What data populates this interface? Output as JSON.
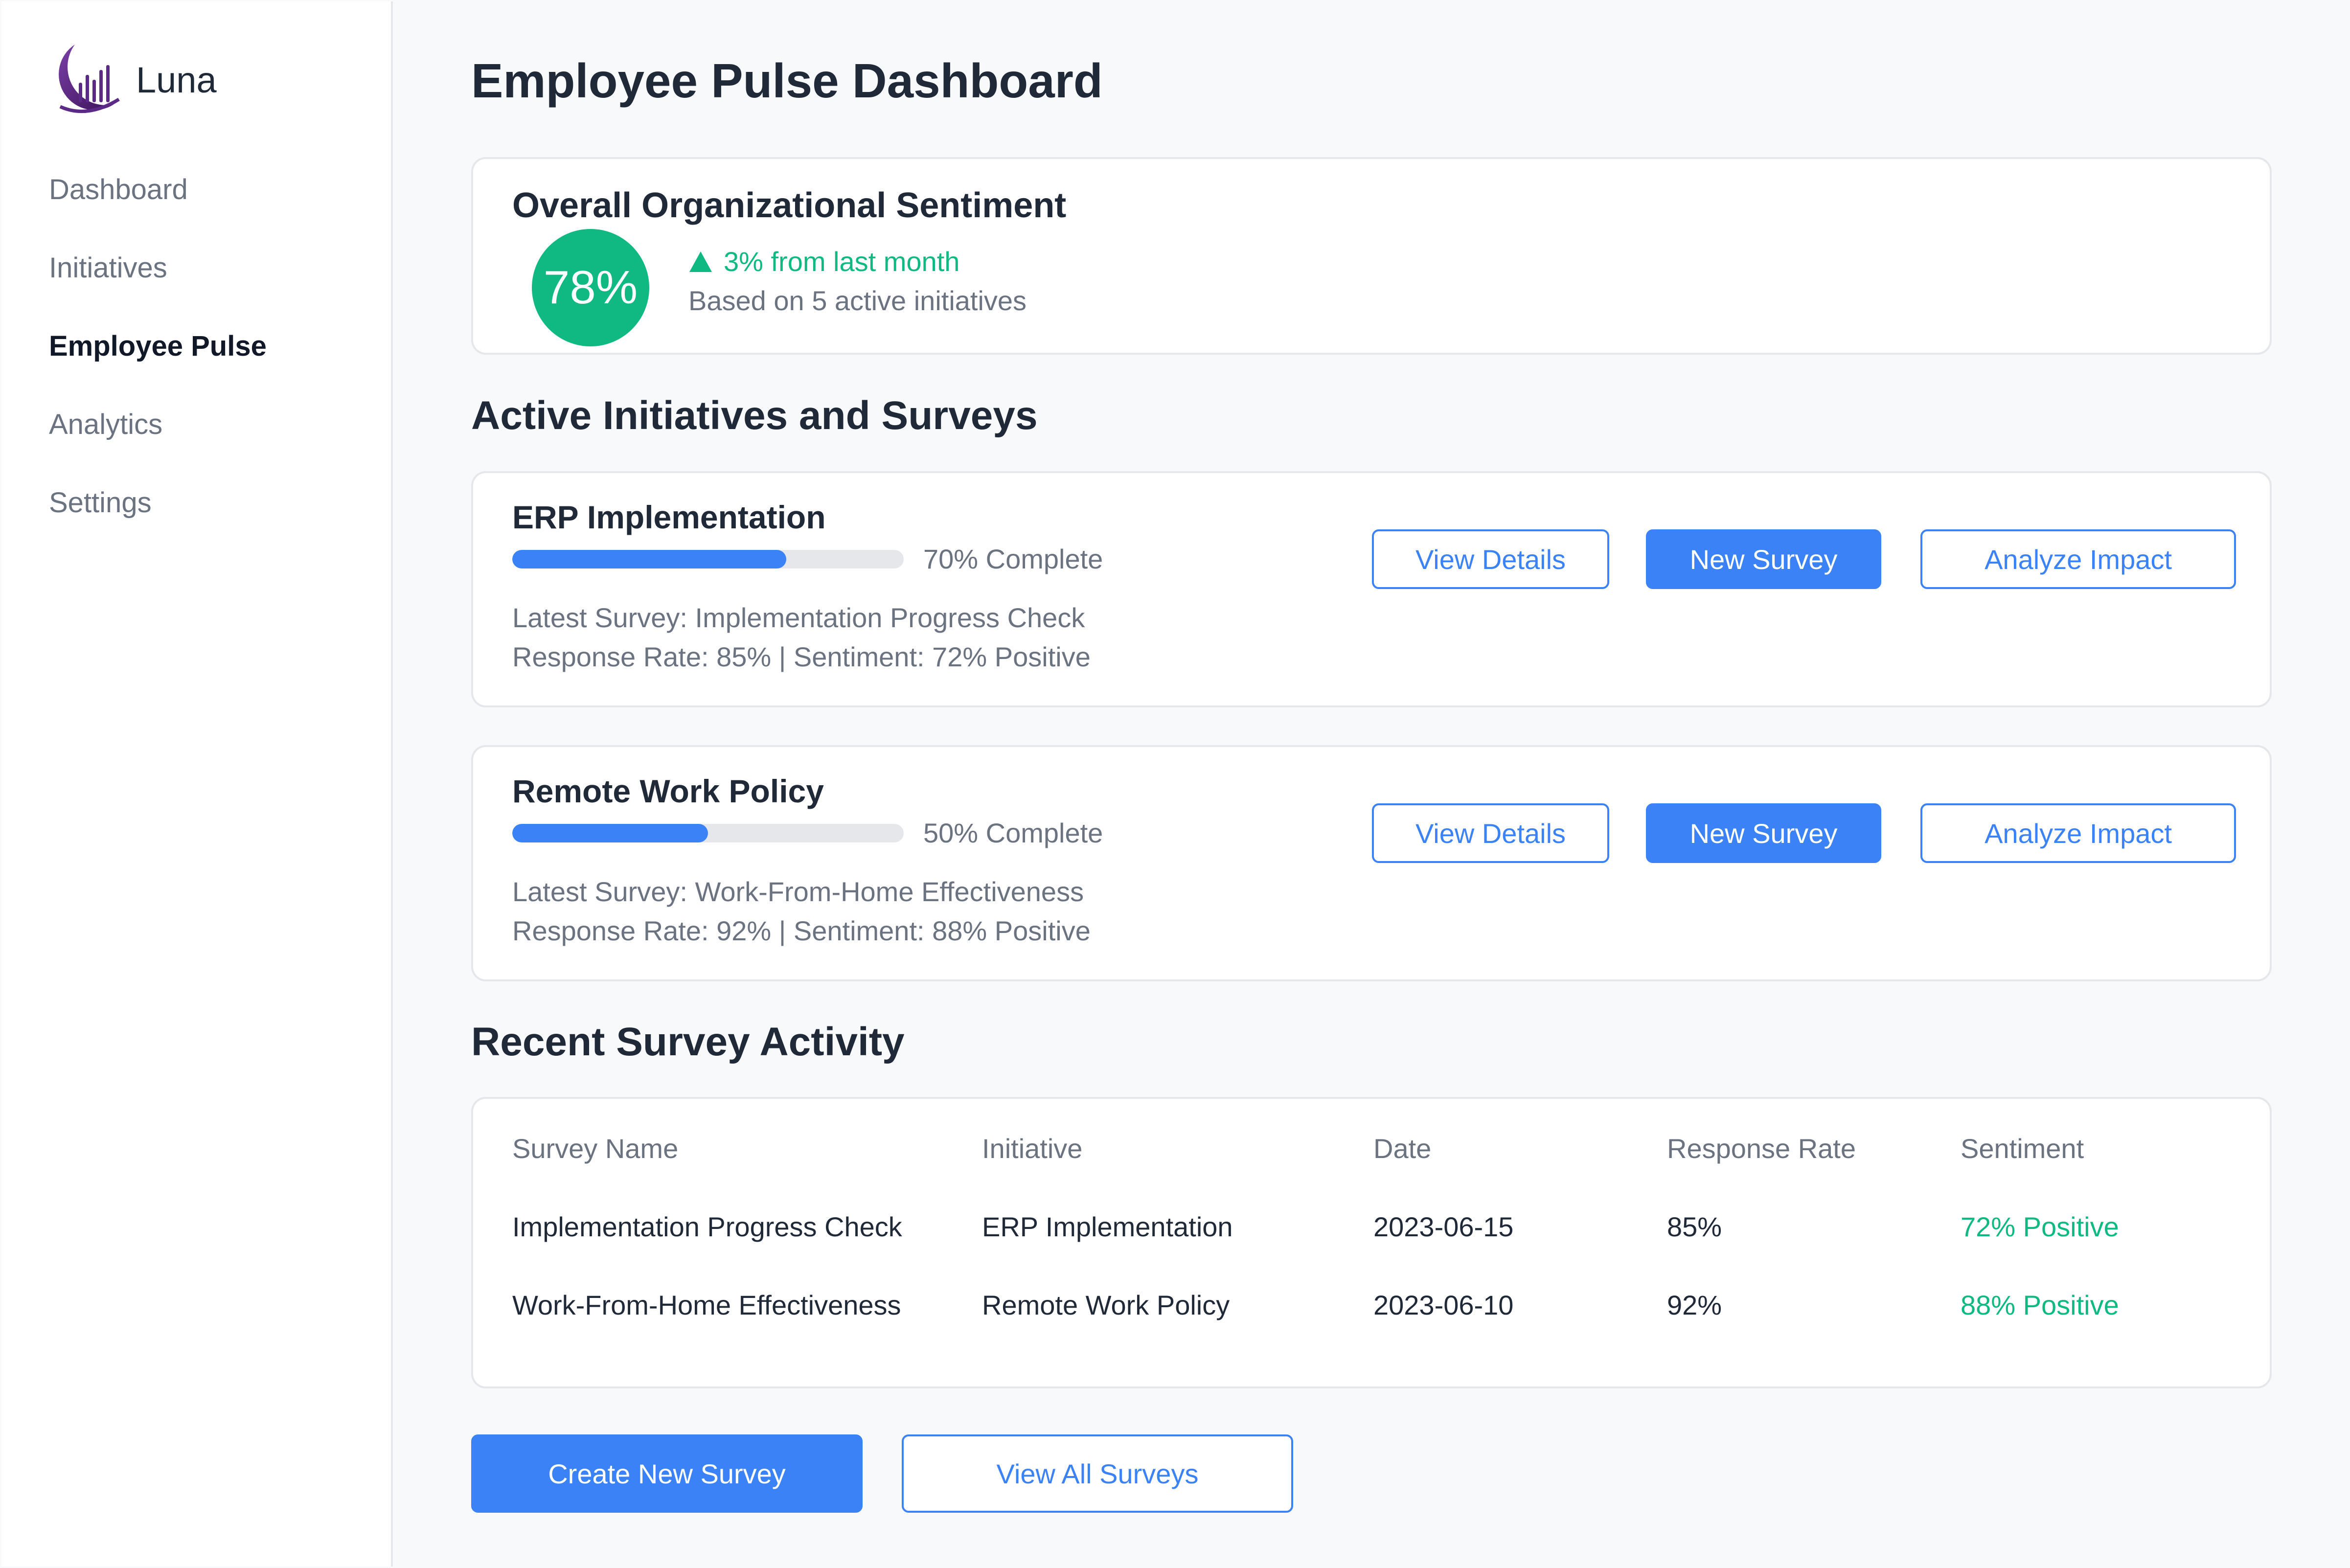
{
  "brand": {
    "name": "Luna",
    "logo_icon": "luna-logo-icon"
  },
  "sidebar": {
    "items": [
      {
        "label": "Dashboard",
        "active": false
      },
      {
        "label": "Initiatives",
        "active": false
      },
      {
        "label": "Employee Pulse",
        "active": true
      },
      {
        "label": "Analytics",
        "active": false
      },
      {
        "label": "Settings",
        "active": false
      }
    ]
  },
  "page": {
    "title": "Employee Pulse Dashboard"
  },
  "sentiment": {
    "title": "Overall Organizational Sentiment",
    "score": "78%",
    "trend_icon": "triangle-up-icon",
    "trend_text": "3% from last month",
    "basis": "Based on 5 active initiatives",
    "color": "#10b981"
  },
  "initiatives_section": {
    "title": "Active Initiatives and Surveys"
  },
  "initiatives": [
    {
      "name": "ERP Implementation",
      "progress": 0.7,
      "progress_label": "70% Complete",
      "latest_survey": "Latest Survey: Implementation Progress Check",
      "stats": "Response Rate: 85% | Sentiment: 72% Positive",
      "view_label": "View Details",
      "new_label": "New Survey",
      "analyze_label": "Analyze Impact"
    },
    {
      "name": "Remote Work Policy",
      "progress": 0.5,
      "progress_label": "50% Complete",
      "latest_survey": "Latest Survey: Work-From-Home Effectiveness",
      "stats": "Response Rate: 92% | Sentiment: 88% Positive",
      "view_label": "View Details",
      "new_label": "New Survey",
      "analyze_label": "Analyze Impact"
    }
  ],
  "activity": {
    "title": "Recent Survey Activity",
    "columns": [
      "Survey Name",
      "Initiative",
      "Date",
      "Response Rate",
      "Sentiment"
    ],
    "rows": [
      [
        "Implementation Progress Check",
        "ERP Implementation",
        "2023-06-15",
        "85%",
        "72% Positive"
      ],
      [
        "Work-From-Home Effectiveness",
        "Remote Work Policy",
        "2023-06-10",
        "92%",
        "88% Positive"
      ]
    ]
  },
  "actions": {
    "create_label": "Create New Survey",
    "view_all_label": "View All Surveys"
  },
  "colors": {
    "accent": "#3b82f6",
    "positive": "#10b981",
    "brand": "#5b2a86"
  }
}
